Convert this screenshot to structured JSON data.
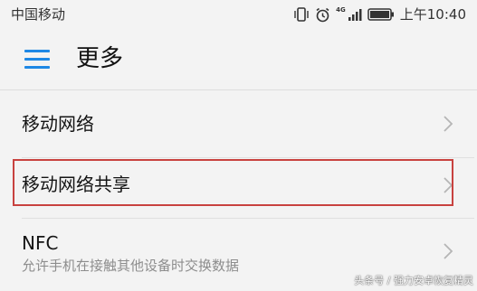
{
  "status_bar": {
    "carrier": "中国移动",
    "network_label": "4G",
    "time": "上午10:40",
    "icons": [
      "vibrate-icon",
      "alarm-icon",
      "signal-icon",
      "battery-icon"
    ]
  },
  "header": {
    "menu_icon": "menu-icon",
    "title": "更多"
  },
  "list": {
    "items": [
      {
        "label": "移动网络",
        "subtitle": "",
        "chevron": "chevron-right-icon"
      },
      {
        "label": "移动网络共享",
        "subtitle": "",
        "chevron": "chevron-right-icon",
        "highlighted": true
      },
      {
        "label": "NFC",
        "subtitle": "允许手机在接触其他设备时交换数据",
        "chevron": "chevron-right-icon"
      }
    ]
  },
  "watermark": "头条号 / 强力安卓恢复精灵",
  "colors": {
    "accent": "#1e88e5",
    "highlight_border": "#c8423f",
    "background": "#f3f3f3",
    "subtitle": "#8d8d8d"
  }
}
